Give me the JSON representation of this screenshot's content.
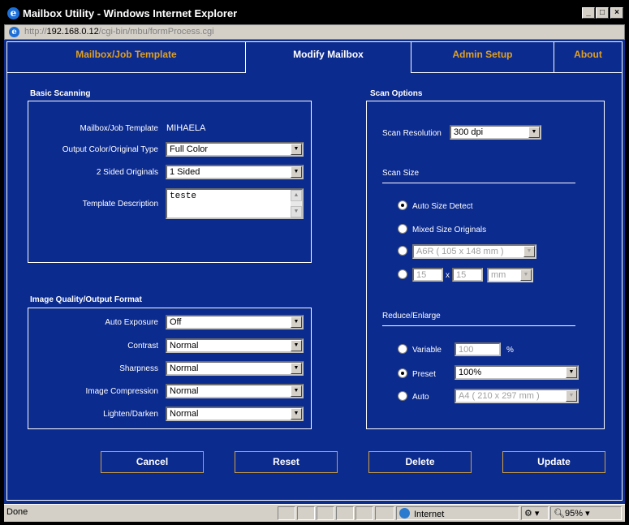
{
  "window": {
    "title": "Mailbox Utility - Windows Internet Explorer",
    "url_prefix": "http://",
    "url_host": "192.168.0.12",
    "url_path": "/cgi-bin/mbu/formProcess.cgi"
  },
  "tabs": [
    {
      "label": "Mailbox/Job Template",
      "active": false
    },
    {
      "label": "Modify Mailbox",
      "active": true
    },
    {
      "label": "Admin Setup",
      "active": false
    },
    {
      "label": "About",
      "active": false
    }
  ],
  "basic_scanning": {
    "title": "Basic Scanning",
    "mailbox_label": "Mailbox/Job Template",
    "mailbox_value": "MIHAELA",
    "output_color_label": "Output Color/Original Type",
    "output_color_value": "Full Color",
    "sided_label": "2 Sided Originals",
    "sided_value": "1 Sided",
    "description_label": "Template Description",
    "description_value": "teste"
  },
  "image_quality": {
    "title": "Image Quality/Output Format",
    "auto_exposure_label": "Auto Exposure",
    "auto_exposure_value": "Off",
    "contrast_label": "Contrast",
    "contrast_value": "Normal",
    "sharpness_label": "Sharpness",
    "sharpness_value": "Normal",
    "compression_label": "Image Compression",
    "compression_value": "Normal",
    "lighten_label": "Lighten/Darken",
    "lighten_value": "Normal"
  },
  "scan_options": {
    "title": "Scan Options",
    "resolution_label": "Scan Resolution",
    "resolution_value": "300 dpi",
    "scan_size_title": "Scan Size",
    "auto_size_label": "Auto Size Detect",
    "mixed_size_label": "Mixed Size Originals",
    "paper_size_value": "A6R ( 105 x 148 mm )",
    "custom_width": "15",
    "custom_x": "x",
    "custom_height": "15",
    "custom_unit": "mm",
    "reduce_title": "Reduce/Enlarge",
    "variable_label": "Variable",
    "variable_value": "100",
    "percent_sign": "%",
    "preset_label": "Preset",
    "preset_value": "100%",
    "auto_label": "Auto",
    "auto_value": "A4 ( 210 x 297 mm )"
  },
  "buttons": {
    "cancel": "Cancel",
    "reset": "Reset",
    "delete": "Delete",
    "update": "Update"
  },
  "status": {
    "text": "Done",
    "zone": "Internet",
    "zoom": "95%"
  }
}
